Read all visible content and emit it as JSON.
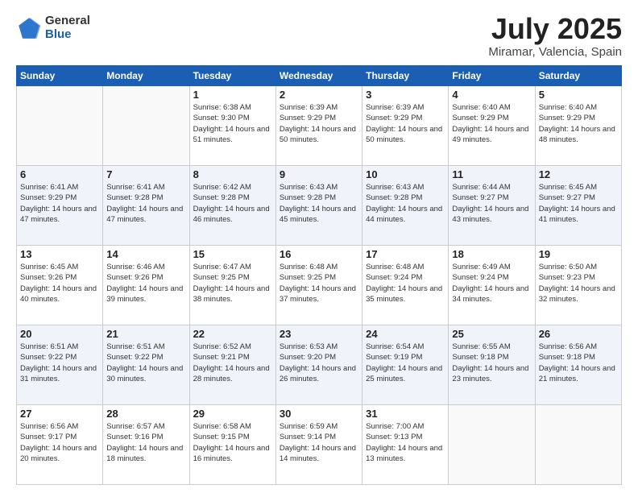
{
  "header": {
    "logo": {
      "general": "General",
      "blue": "Blue"
    },
    "title": "July 2025",
    "location": "Miramar, Valencia, Spain"
  },
  "days_of_week": [
    "Sunday",
    "Monday",
    "Tuesday",
    "Wednesday",
    "Thursday",
    "Friday",
    "Saturday"
  ],
  "weeks": [
    [
      {
        "day": "",
        "info": ""
      },
      {
        "day": "",
        "info": ""
      },
      {
        "day": "1",
        "sunrise": "6:38 AM",
        "sunset": "9:30 PM",
        "daylight": "14 hours and 51 minutes."
      },
      {
        "day": "2",
        "sunrise": "6:39 AM",
        "sunset": "9:29 PM",
        "daylight": "14 hours and 50 minutes."
      },
      {
        "day": "3",
        "sunrise": "6:39 AM",
        "sunset": "9:29 PM",
        "daylight": "14 hours and 50 minutes."
      },
      {
        "day": "4",
        "sunrise": "6:40 AM",
        "sunset": "9:29 PM",
        "daylight": "14 hours and 49 minutes."
      },
      {
        "day": "5",
        "sunrise": "6:40 AM",
        "sunset": "9:29 PM",
        "daylight": "14 hours and 48 minutes."
      }
    ],
    [
      {
        "day": "6",
        "sunrise": "6:41 AM",
        "sunset": "9:29 PM",
        "daylight": "14 hours and 47 minutes."
      },
      {
        "day": "7",
        "sunrise": "6:41 AM",
        "sunset": "9:28 PM",
        "daylight": "14 hours and 47 minutes."
      },
      {
        "day": "8",
        "sunrise": "6:42 AM",
        "sunset": "9:28 PM",
        "daylight": "14 hours and 46 minutes."
      },
      {
        "day": "9",
        "sunrise": "6:43 AM",
        "sunset": "9:28 PM",
        "daylight": "14 hours and 45 minutes."
      },
      {
        "day": "10",
        "sunrise": "6:43 AM",
        "sunset": "9:28 PM",
        "daylight": "14 hours and 44 minutes."
      },
      {
        "day": "11",
        "sunrise": "6:44 AM",
        "sunset": "9:27 PM",
        "daylight": "14 hours and 43 minutes."
      },
      {
        "day": "12",
        "sunrise": "6:45 AM",
        "sunset": "9:27 PM",
        "daylight": "14 hours and 41 minutes."
      }
    ],
    [
      {
        "day": "13",
        "sunrise": "6:45 AM",
        "sunset": "9:26 PM",
        "daylight": "14 hours and 40 minutes."
      },
      {
        "day": "14",
        "sunrise": "6:46 AM",
        "sunset": "9:26 PM",
        "daylight": "14 hours and 39 minutes."
      },
      {
        "day": "15",
        "sunrise": "6:47 AM",
        "sunset": "9:25 PM",
        "daylight": "14 hours and 38 minutes."
      },
      {
        "day": "16",
        "sunrise": "6:48 AM",
        "sunset": "9:25 PM",
        "daylight": "14 hours and 37 minutes."
      },
      {
        "day": "17",
        "sunrise": "6:48 AM",
        "sunset": "9:24 PM",
        "daylight": "14 hours and 35 minutes."
      },
      {
        "day": "18",
        "sunrise": "6:49 AM",
        "sunset": "9:24 PM",
        "daylight": "14 hours and 34 minutes."
      },
      {
        "day": "19",
        "sunrise": "6:50 AM",
        "sunset": "9:23 PM",
        "daylight": "14 hours and 32 minutes."
      }
    ],
    [
      {
        "day": "20",
        "sunrise": "6:51 AM",
        "sunset": "9:22 PM",
        "daylight": "14 hours and 31 minutes."
      },
      {
        "day": "21",
        "sunrise": "6:51 AM",
        "sunset": "9:22 PM",
        "daylight": "14 hours and 30 minutes."
      },
      {
        "day": "22",
        "sunrise": "6:52 AM",
        "sunset": "9:21 PM",
        "daylight": "14 hours and 28 minutes."
      },
      {
        "day": "23",
        "sunrise": "6:53 AM",
        "sunset": "9:20 PM",
        "daylight": "14 hours and 26 minutes."
      },
      {
        "day": "24",
        "sunrise": "6:54 AM",
        "sunset": "9:19 PM",
        "daylight": "14 hours and 25 minutes."
      },
      {
        "day": "25",
        "sunrise": "6:55 AM",
        "sunset": "9:18 PM",
        "daylight": "14 hours and 23 minutes."
      },
      {
        "day": "26",
        "sunrise": "6:56 AM",
        "sunset": "9:18 PM",
        "daylight": "14 hours and 21 minutes."
      }
    ],
    [
      {
        "day": "27",
        "sunrise": "6:56 AM",
        "sunset": "9:17 PM",
        "daylight": "14 hours and 20 minutes."
      },
      {
        "day": "28",
        "sunrise": "6:57 AM",
        "sunset": "9:16 PM",
        "daylight": "14 hours and 18 minutes."
      },
      {
        "day": "29",
        "sunrise": "6:58 AM",
        "sunset": "9:15 PM",
        "daylight": "14 hours and 16 minutes."
      },
      {
        "day": "30",
        "sunrise": "6:59 AM",
        "sunset": "9:14 PM",
        "daylight": "14 hours and 14 minutes."
      },
      {
        "day": "31",
        "sunrise": "7:00 AM",
        "sunset": "9:13 PM",
        "daylight": "14 hours and 13 minutes."
      },
      {
        "day": "",
        "info": ""
      },
      {
        "day": "",
        "info": ""
      }
    ]
  ]
}
